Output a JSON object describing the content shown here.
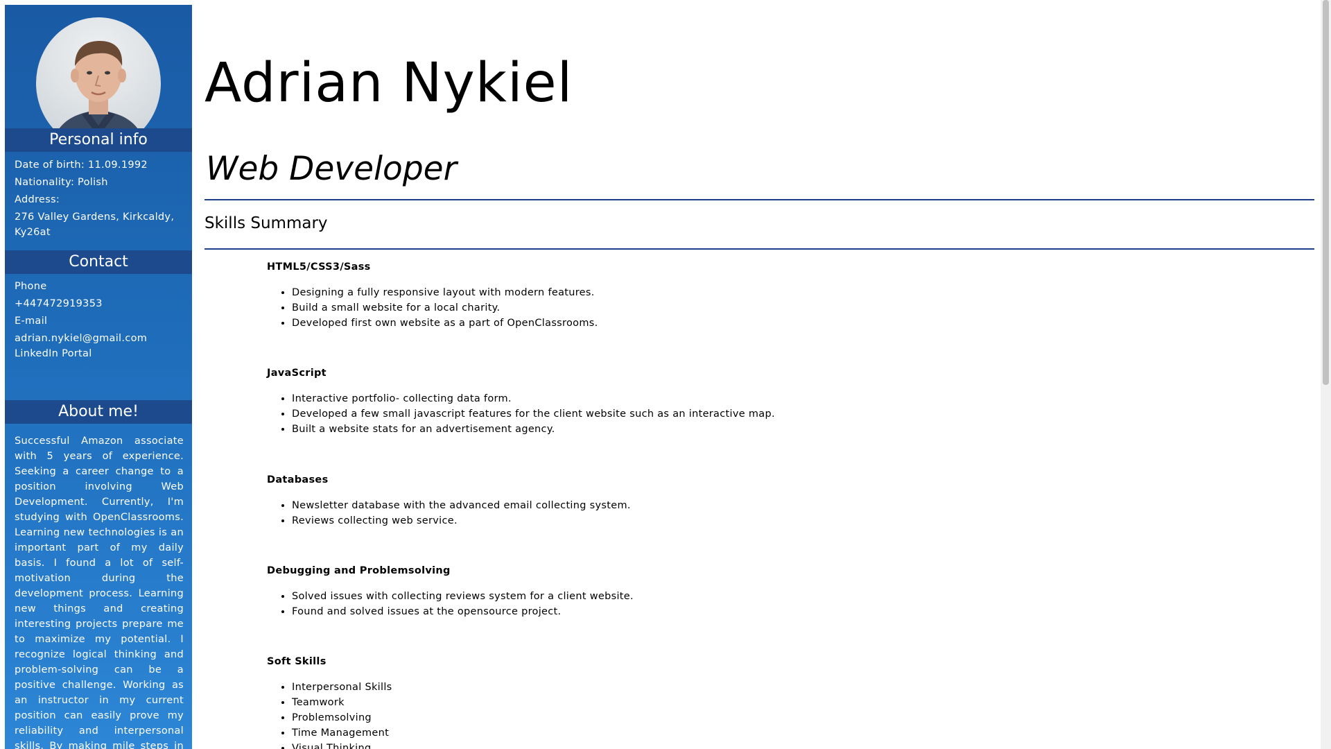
{
  "sidebar": {
    "personal_info_header": "Personal info",
    "dob": "Date of birth: 11.09.1992",
    "nationality": "Nationality: Polish",
    "address_label": "Address:",
    "address_line1": "276 Valley Gardens, Kirkcaldy,",
    "address_line2": "Ky26at",
    "contact_header": "Contact",
    "phone_label": "Phone",
    "phone_value": "+447472919353",
    "email_label": "E-mail",
    "email_value": "adrian.nykiel@gmail.com",
    "linkedin_label": "LinkedIn Portal",
    "about_header": "About me!",
    "about_text": "Successful Amazon associate with 5 years of experience. Seeking a career change to a position involving Web Development. Currently, I'm studying with OpenClassrooms. Learning new technologies is an important part of my daily basis. I found a lot of self-motivation during the development process. Learning new things and creating interesting projects prepare me to maximize my potential. I recognize logical thinking and problem-solving can be a positive challenge. Working as an instructor in my current position can easily prove my reliability and interpersonal skills. By making mile steps in Web Development I hope to push my career and"
  },
  "main": {
    "name": "Adrian Nykiel",
    "role": "Web Developer",
    "skills_title": "Skills Summary",
    "skills": [
      {
        "title": "HTML5/CSS3/Sass",
        "items": [
          "Designing a fully responsive layout with modern features.",
          "Build a small website for a local charity.",
          "Developed first own website as a part of OpenClassrooms."
        ]
      },
      {
        "title": "JavaScript",
        "items": [
          "Interactive portfolio- collecting data form.",
          "Developed a few small javascript features for the client website such as an interactive map.",
          "Built a website stats for an advertisement agency."
        ]
      },
      {
        "title": "Databases",
        "items": [
          "Newsletter database with the advanced email collecting system.",
          "Reviews collecting web service."
        ]
      },
      {
        "title": "Debugging and Problemsolving",
        "items": [
          "Solved issues with collecting reviews system for a client website.",
          "Found and solved issues at the opensource project."
        ]
      },
      {
        "title": "Soft Skills",
        "items": [
          "Interpersonal Skills",
          "Teamwork",
          "Problemsolving",
          "Time Management",
          "Visual Thinking"
        ]
      }
    ]
  },
  "colors": {
    "sidebar_top": "#1a5aa4",
    "sidebar_bottom": "#2d86d6",
    "section_header": "#1c4a8c",
    "divider": "#1c3f8c"
  },
  "icons": {
    "avatar": "profile-photo"
  }
}
